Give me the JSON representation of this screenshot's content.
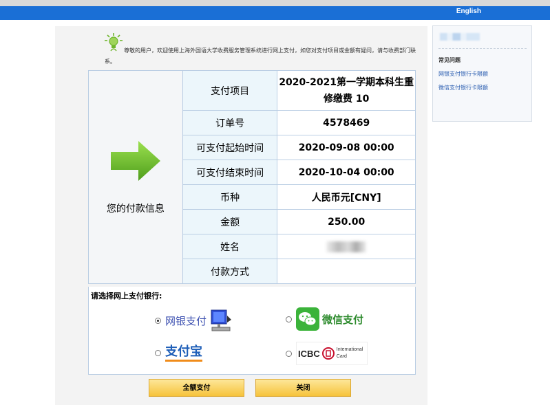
{
  "header": {
    "lang_link": "English"
  },
  "notice": "尊敬的用户，欢迎使用上海外国语大学收费服务管理系统进行网上支付，如您对支付项目或金额有疑问，请与收费部门联系。",
  "sidebar": {
    "title": "常见问题",
    "links": [
      "网银支付银行卡限额",
      "微信支付银行卡限额"
    ]
  },
  "payment_info": {
    "section_label": "您的付款信息",
    "rows": [
      {
        "label": "支付项目",
        "value": "2020-2021第一学期本科生重修缴费 10"
      },
      {
        "label": "订单号",
        "value": "4578469"
      },
      {
        "label": "可支付起始时间",
        "value": "2020-09-08 00:00"
      },
      {
        "label": "可支付结束时间",
        "value": "2020-10-04 00:00"
      },
      {
        "label": "币种",
        "value": "人民币元[CNY]"
      },
      {
        "label": "金额",
        "value": "250.00"
      },
      {
        "label": "姓名",
        "value": ""
      },
      {
        "label": "付款方式",
        "value": ""
      }
    ]
  },
  "bank_selection": {
    "title": "请选择网上支付银行:",
    "options": [
      {
        "label": "网银支付",
        "selected": true
      },
      {
        "label": "微信支付",
        "selected": false
      },
      {
        "label": "支付宝",
        "selected": false
      },
      {
        "label": "ICBC",
        "sub": "International",
        "sub2": "Card",
        "selected": false
      }
    ]
  },
  "buttons": {
    "pay_all": "全额支付",
    "close": "关闭"
  },
  "colors": {
    "topbar": "#1a6fd6",
    "arrow": "#6cbf2a",
    "button": "#f6c33b",
    "link": "#2a5db0"
  }
}
